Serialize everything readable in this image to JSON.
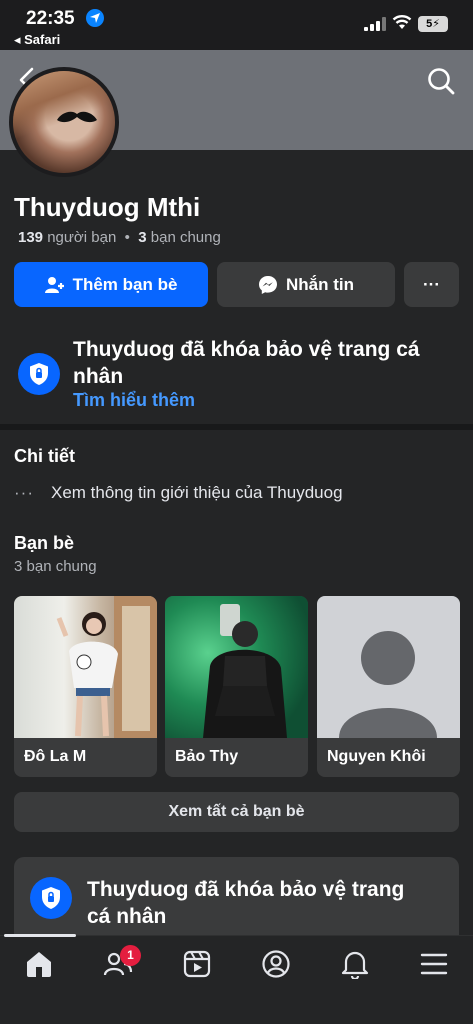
{
  "status_bar": {
    "time": "22:35",
    "back_app": "◂ Safari",
    "battery": "5"
  },
  "profile": {
    "name": "Thuyduog Mthi",
    "friends_count": "139",
    "friends_label": "người bạn",
    "separator": "•",
    "mutual_count": "3",
    "mutual_label": "bạn chung"
  },
  "actions": {
    "add_friend": "Thêm bạn bè",
    "message": "Nhắn tin",
    "more": "···"
  },
  "lock_notice": {
    "title": "Thuyduog đã khóa bảo vệ trang cá nhân",
    "learn_more": "Tìm hiểu thêm"
  },
  "details": {
    "heading": "Chi tiết",
    "about_dots": "···",
    "about_text": "Xem thông tin giới thiệu của Thuyduog"
  },
  "friends": {
    "heading": "Bạn bè",
    "mutual": "3 bạn chung",
    "items": [
      {
        "name": "Đô La M"
      },
      {
        "name": "Bảo Thy"
      },
      {
        "name": "Nguyen Khôi"
      }
    ],
    "see_all": "Xem tất cả bạn bè"
  },
  "lock_notice_2": {
    "title": "Thuyduog đã khóa bảo vệ trang cá nhân"
  },
  "tabbar": {
    "notifications_badge": "1"
  },
  "colors": {
    "accent": "#0866ff",
    "link": "#4599ff",
    "background": "#242526",
    "badge": "#e41e3f"
  }
}
